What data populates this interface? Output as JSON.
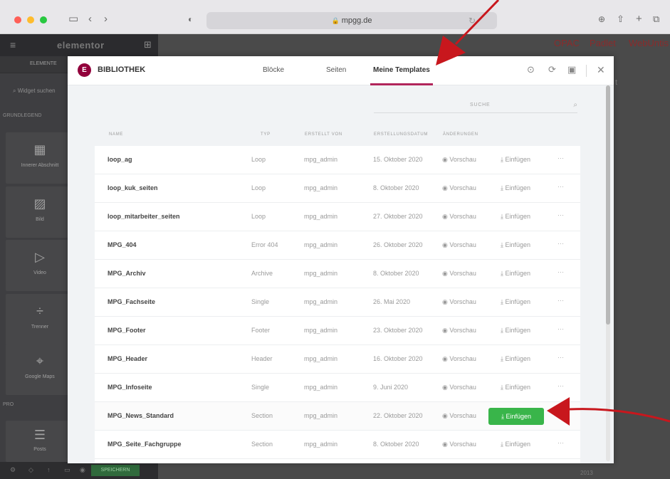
{
  "browser": {
    "url": "mpgg.de",
    "colors": {
      "close": "#fe5f57",
      "minimize": "#febc2e",
      "zoom": "#28c840"
    }
  },
  "editor": {
    "logo": "elementor",
    "tabs": {
      "elements": "ELEMENTE"
    },
    "search_placeholder": "Widget suchen",
    "sections": {
      "basic": "GRUNDLEGEND",
      "pro": "PRO"
    },
    "widgets": [
      {
        "label": "Innerer Abschnitt",
        "icon": "inner-section-icon"
      },
      {
        "label": "Bild",
        "icon": "image-icon"
      },
      {
        "label": "Video",
        "icon": "video-icon"
      },
      {
        "label": "Trenner",
        "icon": "divider-icon"
      },
      {
        "label": "Google Maps",
        "icon": "map-icon"
      },
      {
        "label": "Posts",
        "icon": "posts-icon"
      }
    ],
    "save_label": "SPEICHERN",
    "nav_links": [
      "OPAC",
      "Padlet",
      "WebUntis"
    ],
    "stray": {
      "t": "t",
      "year": "2013"
    }
  },
  "modal": {
    "title": "BIBLIOTHEK",
    "tabs": [
      {
        "label": "Blöcke",
        "active": false
      },
      {
        "label": "Seiten",
        "active": false
      },
      {
        "label": "Meine Templates",
        "active": true
      }
    ],
    "accent": "#92003b",
    "search_placeholder": "SUCHE",
    "columns": {
      "name": "NAME",
      "typ": "TYP",
      "von": "ERSTELLT VON",
      "datum": "ERSTELLUNGSDATUM",
      "aktionen": "ÄNDERUNGEN"
    },
    "preview_label": "Vorschau",
    "insert_label": "Einfügen",
    "more_label": "···",
    "rows": [
      {
        "name": "loop_ag",
        "typ": "Loop",
        "von": "mpg_admin",
        "datum": "15. Oktober 2020"
      },
      {
        "name": "loop_kuk_seiten",
        "typ": "Loop",
        "von": "mpg_admin",
        "datum": "8. Oktober 2020"
      },
      {
        "name": "loop_mitarbeiter_seiten",
        "typ": "Loop",
        "von": "mpg_admin",
        "datum": "27. Oktober 2020"
      },
      {
        "name": "MPG_404",
        "typ": "Error 404",
        "von": "mpg_admin",
        "datum": "26. Oktober 2020"
      },
      {
        "name": "MPG_Archiv",
        "typ": "Archive",
        "von": "mpg_admin",
        "datum": "8. Oktober 2020"
      },
      {
        "name": "MPG_Fachseite",
        "typ": "Single",
        "von": "mpg_admin",
        "datum": "26. Mai 2020"
      },
      {
        "name": "MPG_Footer",
        "typ": "Footer",
        "von": "mpg_admin",
        "datum": "23. Oktober 2020"
      },
      {
        "name": "MPG_Header",
        "typ": "Header",
        "von": "mpg_admin",
        "datum": "16. Oktober 2020"
      },
      {
        "name": "MPG_Infoseite",
        "typ": "Single",
        "von": "mpg_admin",
        "datum": "9. Juni 2020"
      },
      {
        "name": "MPG_News_Standard",
        "typ": "Section",
        "von": "mpg_admin",
        "datum": "22. Oktober 2020",
        "hovered": true
      },
      {
        "name": "MPG_Seite_Fachgruppe",
        "typ": "Section",
        "von": "mpg_admin",
        "datum": "8. Oktober 2020"
      }
    ],
    "insert_button_color": "#39b54a"
  },
  "annotations": {
    "arrow_color": "#c8171d"
  }
}
